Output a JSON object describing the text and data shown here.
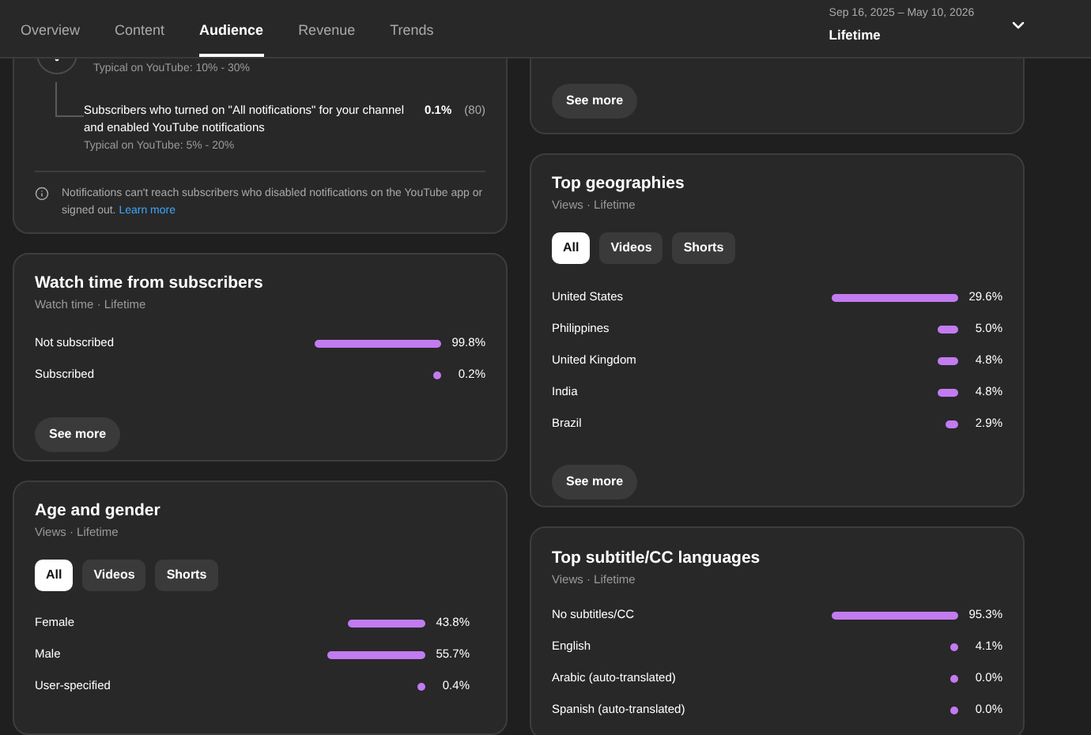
{
  "tabs": [
    {
      "label": "Overview",
      "selected": false
    },
    {
      "label": "Content",
      "selected": false
    },
    {
      "label": "Audience",
      "selected": true
    },
    {
      "label": "Revenue",
      "selected": false
    },
    {
      "label": "Trends",
      "selected": false
    }
  ],
  "date_range": {
    "range": "Sep 16, 2025 – May 10, 2026",
    "period": "Lifetime"
  },
  "notifications_card": {
    "top_typical": "Typical on YouTube: 10% - 30%",
    "row": {
      "label": "Subscribers who turned on \"All notifications\" for your channel and enabled YouTube notifications",
      "value": "0.1%",
      "count": "(80)",
      "typical": "Typical on YouTube: 5% - 20%"
    },
    "note": "Notifications can't reach subscribers who disabled notifications on the YouTube app or signed out.",
    "link": "Learn more"
  },
  "top_right_card": {
    "button": "See more"
  },
  "watch_time": {
    "title": "Watch time from subscribers",
    "subtitle": "Watch time · Lifetime",
    "rows": [
      {
        "label": "Not subscribed",
        "value": "99.8%"
      },
      {
        "label": "Subscribed",
        "value": "0.2%"
      }
    ],
    "button": "See more"
  },
  "age_gender": {
    "title": "Age and gender",
    "subtitle": "Views · Lifetime",
    "chips": [
      {
        "label": "All",
        "selected": true
      },
      {
        "label": "Videos",
        "selected": false
      },
      {
        "label": "Shorts",
        "selected": false
      }
    ],
    "rows": [
      {
        "label": "Female",
        "value": "43.8%"
      },
      {
        "label": "Male",
        "value": "55.7%"
      },
      {
        "label": "User-specified",
        "value": "0.4%"
      }
    ]
  },
  "geographies": {
    "title": "Top geographies",
    "subtitle": "Views · Lifetime",
    "chips": [
      {
        "label": "All",
        "selected": true
      },
      {
        "label": "Videos",
        "selected": false
      },
      {
        "label": "Shorts",
        "selected": false
      }
    ],
    "rows": [
      {
        "label": "United States",
        "value": "29.6%"
      },
      {
        "label": "Philippines",
        "value": "5.0%"
      },
      {
        "label": "United Kingdom",
        "value": "4.8%"
      },
      {
        "label": "India",
        "value": "4.8%"
      },
      {
        "label": "Brazil",
        "value": "2.9%"
      }
    ],
    "button": "See more"
  },
  "subtitles": {
    "title": "Top subtitle/CC languages",
    "subtitle": "Views · Lifetime",
    "rows": [
      {
        "label": "No subtitles/CC",
        "value": "95.3%"
      },
      {
        "label": "English",
        "value": "4.1%"
      },
      {
        "label": "Arabic (auto-translated)",
        "value": "0.0%"
      },
      {
        "label": "Spanish (auto-translated)",
        "value": "0.0%"
      }
    ]
  }
}
